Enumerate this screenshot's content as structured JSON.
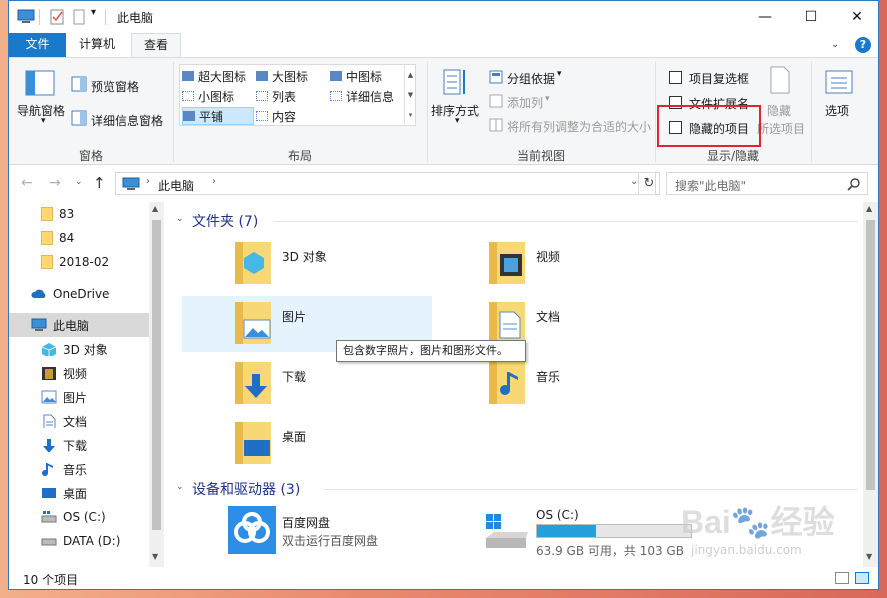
{
  "window": {
    "title": "此电脑",
    "controls": {
      "minimize": "—",
      "maximize": "☐",
      "close": "✕"
    }
  },
  "tabs": [
    {
      "label": "文件"
    },
    {
      "label": "计算机"
    },
    {
      "label": "查看"
    }
  ],
  "ribbon": {
    "panes": {
      "group_label": "窗格",
      "nav_pane": "导航窗格",
      "preview_pane": "预览窗格",
      "details_pane": "详细信息窗格"
    },
    "layout": {
      "group_label": "布局",
      "options": [
        "超大图标",
        "大图标",
        "中图标",
        "小图标",
        "列表",
        "详细信息",
        "平铺",
        "内容"
      ],
      "selected": "平铺"
    },
    "current_view": {
      "group_label": "当前视图",
      "sort_by": "排序方式",
      "group_by": "分组依据",
      "add_column": "添加列",
      "fit_columns": "将所有列调整为合适的大小"
    },
    "show_hide": {
      "group_label": "显示/隐藏",
      "item_checkboxes": "项目复选框",
      "file_extensions": "文件扩展名",
      "hidden_items": "隐藏的项目",
      "hide_selected_1": "隐藏",
      "hide_selected_2": "所选项目"
    },
    "options_label": "选项"
  },
  "nav": {
    "path_root": "此电脑",
    "search_placeholder": "搜索\"此电脑\""
  },
  "sidebar": {
    "items": [
      {
        "label": "83",
        "icon": "folder-icon"
      },
      {
        "label": "84",
        "icon": "folder-icon"
      },
      {
        "label": "2018-02",
        "icon": "folder-icon"
      },
      {
        "label": "OneDrive",
        "icon": "cloud-icon"
      },
      {
        "label": "此电脑",
        "icon": "computer-icon"
      },
      {
        "label": "3D 对象",
        "icon": "cube-icon"
      },
      {
        "label": "视频",
        "icon": "film-icon"
      },
      {
        "label": "图片",
        "icon": "picture-icon"
      },
      {
        "label": "文档",
        "icon": "document-icon"
      },
      {
        "label": "下载",
        "icon": "download-icon"
      },
      {
        "label": "音乐",
        "icon": "music-icon"
      },
      {
        "label": "桌面",
        "icon": "desktop-icon"
      },
      {
        "label": "OS (C:)",
        "icon": "drive-icon"
      },
      {
        "label": "DATA (D:)",
        "icon": "drive-icon"
      }
    ]
  },
  "content": {
    "folders_title": "文件夹 (7)",
    "folders": [
      {
        "label": "3D 对象"
      },
      {
        "label": "视频"
      },
      {
        "label": "图片"
      },
      {
        "label": "文档"
      },
      {
        "label": "下载"
      },
      {
        "label": "音乐"
      },
      {
        "label": "桌面"
      }
    ],
    "tooltip": "包含数字照片，图片和图形文件。",
    "devices_title": "设备和驱动器 (3)",
    "devices": [
      {
        "label": "百度网盘",
        "sub": "双击运行百度网盘"
      },
      {
        "label": "OS (C:)",
        "sub": "63.9 GB 可用，共 103 GB",
        "usage_fraction": 0.38
      }
    ]
  },
  "status": {
    "count": "10 个项目"
  },
  "watermark": {
    "brand": "Bai",
    "brand2": "经验",
    "url": "jingyan.baidu.com"
  },
  "colors": {
    "accent": "#1979ca",
    "selection": "#e5f3ff",
    "highlight_box": "#e0252b",
    "drive_bar": "#26a0da"
  }
}
